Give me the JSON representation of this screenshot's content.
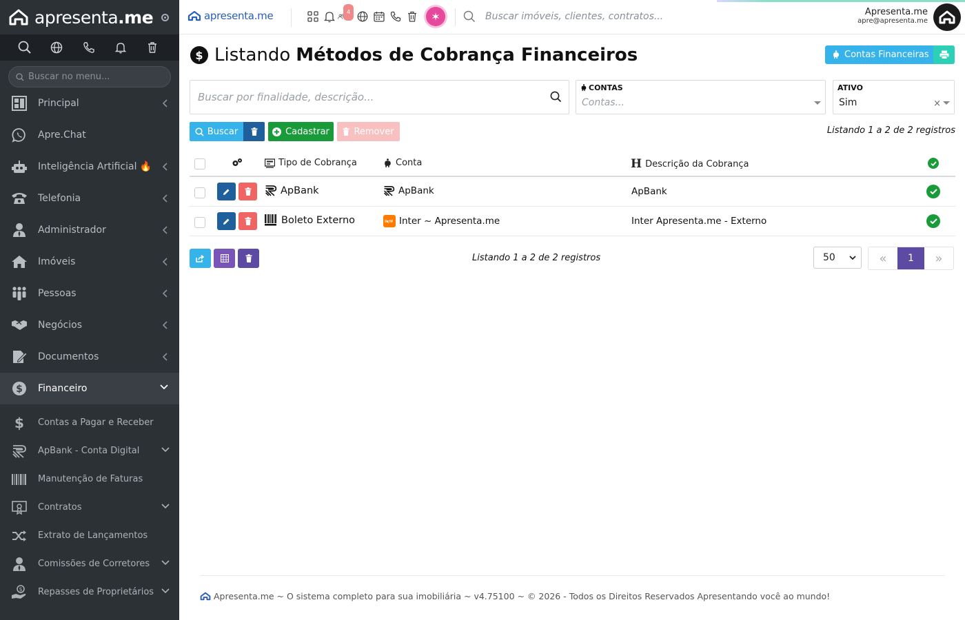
{
  "brand": {
    "name_light": "apresenta",
    "name_bold": ".me"
  },
  "sidebar": {
    "search_placeholder": "Buscar no menu...",
    "items": [
      {
        "label": "Principal",
        "icon": "dashboard-icon"
      },
      {
        "label": "Apre.Chat",
        "icon": "whatsapp-icon"
      },
      {
        "label": "Inteligência Artificial 🔥",
        "icon": "robot-icon"
      },
      {
        "label": "Telefonia",
        "icon": "phone-icon"
      },
      {
        "label": "Administrador",
        "icon": "admin-icon"
      },
      {
        "label": "Imóveis",
        "icon": "home-icon"
      },
      {
        "label": "Pessoas",
        "icon": "people-icon"
      },
      {
        "label": "Negócios",
        "icon": "handshake-icon"
      },
      {
        "label": "Documentos",
        "icon": "document-icon"
      },
      {
        "label": "Financeiro",
        "icon": "dollar-circle-icon"
      }
    ],
    "sub_items": [
      {
        "label": "Contas a Pagar e Receber",
        "icon": "dollar-icon"
      },
      {
        "label": "ApBank - Conta Digital",
        "icon": "apbank-icon"
      },
      {
        "label": "Manutenção de Faturas",
        "icon": "barcode-icon"
      },
      {
        "label": "Contratos",
        "icon": "certificate-icon"
      },
      {
        "label": "Extrato de Lançamentos",
        "icon": "shuffle-icon"
      },
      {
        "label": "Comissões de Corretores",
        "icon": "user-tie-icon"
      },
      {
        "label": "Repasses de Proprietários",
        "icon": "hand-coin-icon"
      }
    ]
  },
  "topbar": {
    "logo_text": "apresenta.me",
    "notification_count": "4",
    "search_placeholder": "Buscar imóveis, clientes, contratos...",
    "user_name": "Apresenta.me",
    "user_email": "apre@apresenta.me"
  },
  "page": {
    "title_light": "Listando",
    "title_bold": "Métodos de Cobrança Financeiros",
    "btn_contas": "Contas Financeiras",
    "search_placeholder": "Buscar por finalidade, descrição...",
    "filter_contas_label": "CONTAS",
    "filter_contas_placeholder": "Contas...",
    "filter_ativo_label": "ATIVO",
    "filter_ativo_value": "Sim",
    "btn_buscar": "Buscar",
    "btn_cadastrar": "Cadastrar",
    "btn_remover": "Remover",
    "count_text": "Listando 1 a 2 de 2 registros"
  },
  "table": {
    "headers": {
      "tipo": "Tipo de Cobrança",
      "conta": "Conta",
      "descricao": "Descrição da Cobrança"
    },
    "rows": [
      {
        "tipo": "ApBank",
        "conta": "ApBank",
        "descricao": "ApBank",
        "ativo": true
      },
      {
        "tipo": "Boleto Externo",
        "conta": "Inter ~ Apresenta.me",
        "descricao": "Inter Apresenta.me - Externo",
        "ativo": true
      }
    ]
  },
  "pagination": {
    "per_page": "50",
    "current_page": "1",
    "count_text": "Listando 1 a 2 de 2 registros"
  },
  "footer": {
    "text": "Apresenta.me ~ O sistema completo para sua imobiliária ~ v4.75100 ~ © 2026 - Todos os Direitos Reservados Apresentando você ao mundo!"
  },
  "colors": {
    "sidebar": "#2c3136",
    "primary": "#36b3ea",
    "dark_blue": "#1e5f9c",
    "green": "#1a9b3a",
    "danger": "#f06464",
    "purple": "#5d4aa3",
    "teal": "#2bd0b6"
  }
}
